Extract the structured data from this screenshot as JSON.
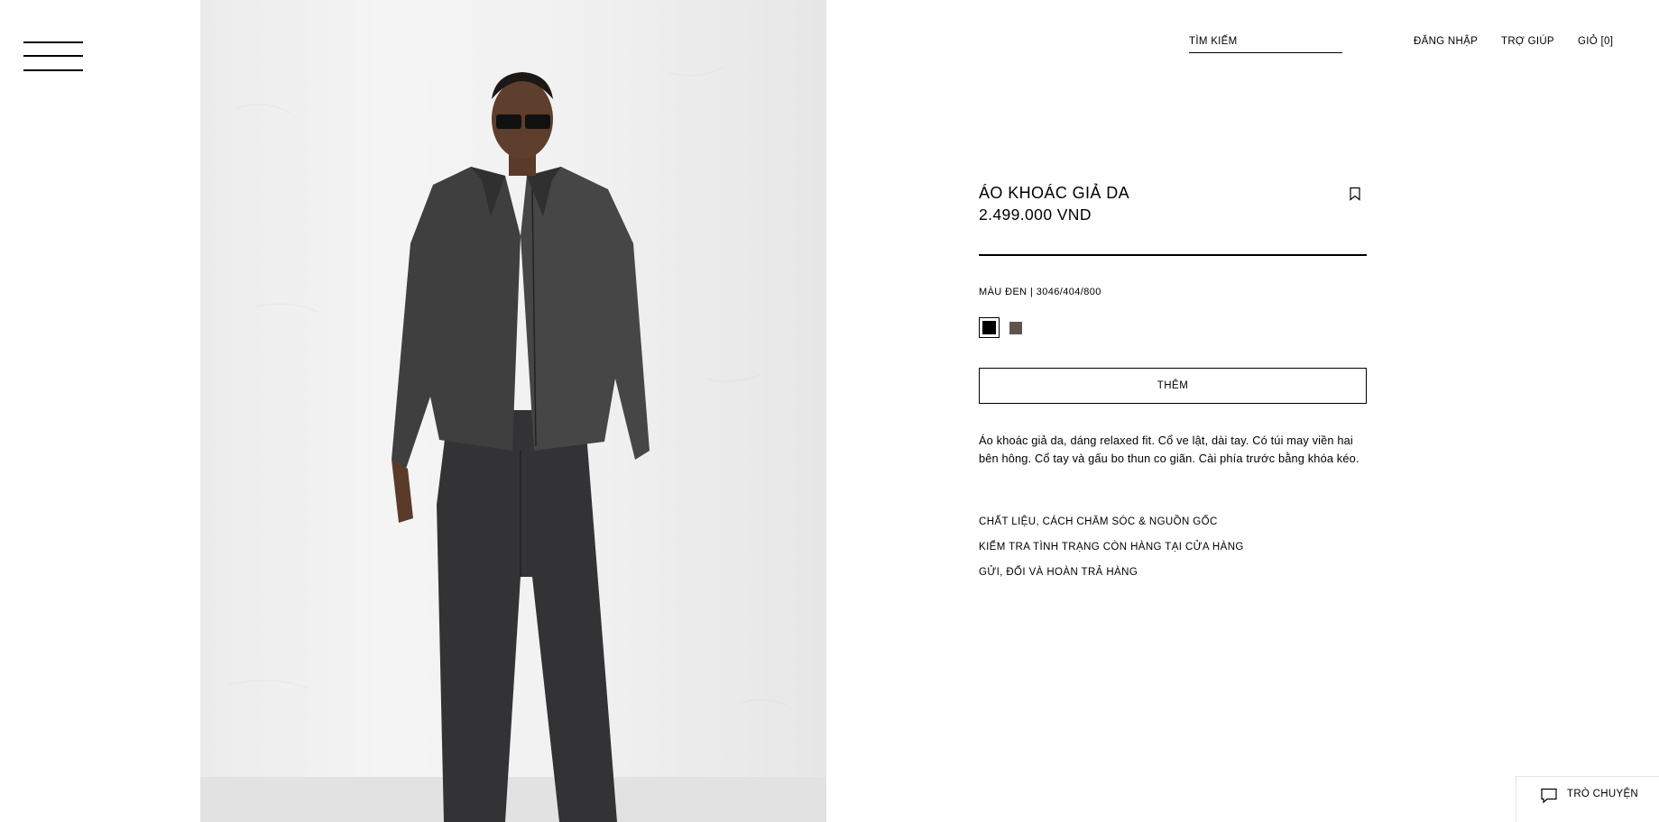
{
  "header": {
    "search_placeholder": "TÌM KIẾM",
    "login": "ĐĂNG NHẬP",
    "help": "TRỢ GIÚP",
    "cart_label": "GIỎ",
    "cart_count": "0"
  },
  "product": {
    "title": "ÁO KHOÁC GIẢ DA",
    "price": "2.499.000 VND",
    "color_name": "MÀU ĐEN",
    "ref": "3046/404/800",
    "swatches": [
      {
        "name": "black",
        "color": "#000000",
        "selected": true
      },
      {
        "name": "brown-grey",
        "color": "#5e544e",
        "selected": false
      }
    ],
    "add_button": "THÊM",
    "description": "Áo khoác giả da, dáng relaxed fit. Cổ ve lật, dài tay. Có túi may viền hai bên hông. Cổ tay và gấu bo thun co giãn. Cài phía trước bằng khóa kéo.",
    "accordion": [
      "CHẤT LIỆU, CÁCH CHĂM SÓC & NGUỒN GỐC",
      "KIỂM TRA TÌNH TRẠNG CÒN HÀNG TẠI CỬA HÀNG",
      "GỬI, ĐỔI VÀ HOÀN TRẢ HÀNG"
    ]
  },
  "chat": {
    "label": "TRÒ CHUYỆN",
    "icon": "chat-bubble-icon"
  },
  "icons": {
    "menu": "hamburger-menu-icon",
    "bookmark": "bookmark-icon"
  }
}
